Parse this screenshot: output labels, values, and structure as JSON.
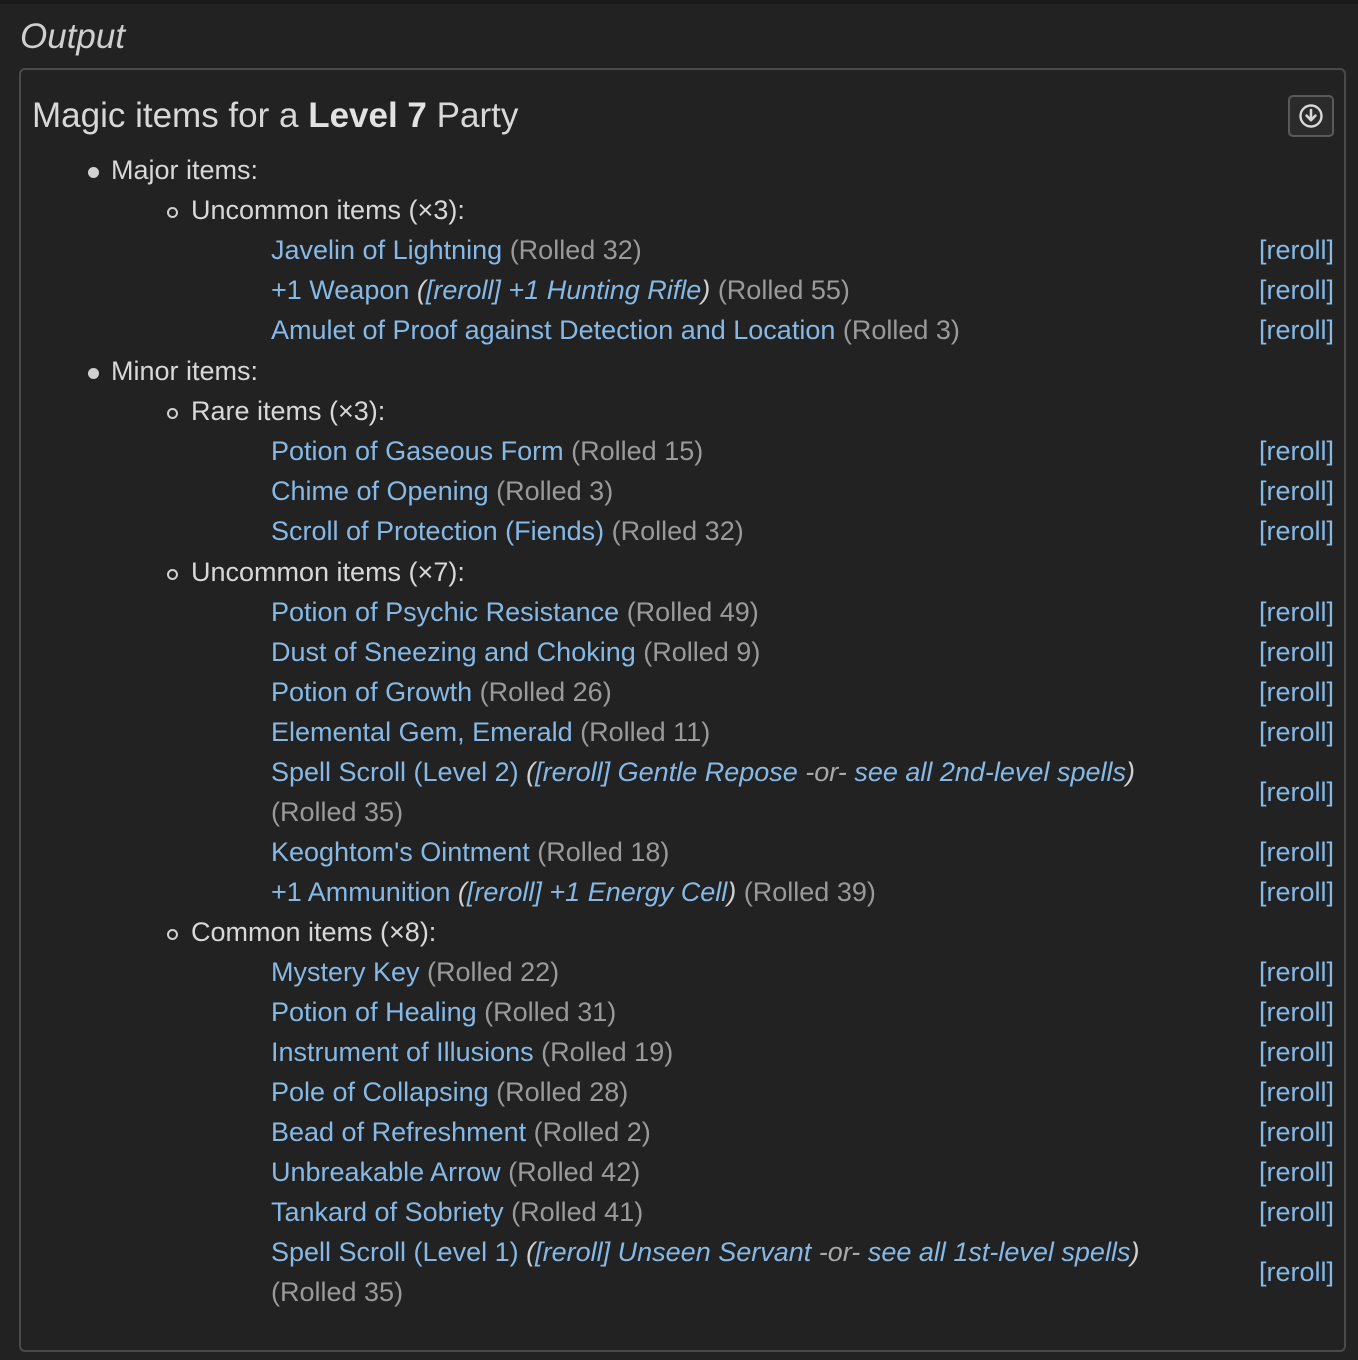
{
  "output_label": "Output",
  "title": {
    "prefix": "Magic items for a ",
    "level": "Level 7",
    "suffix": " Party"
  },
  "download_icon": "download-circle-icon",
  "reroll_label": "[reroll]",
  "or_label": "-or-",
  "groups": {
    "major": {
      "label": "Major items:"
    },
    "minor": {
      "label": "Minor items:"
    }
  },
  "categories": {
    "major_uncommon": "Uncommon items (×3):",
    "minor_rare": "Rare items (×3):",
    "minor_uncommon": "Uncommon items (×7):",
    "minor_common": "Common items (×8):"
  },
  "items": {
    "i1": {
      "name": "Javelin of Lightning",
      "rolled": "(Rolled 32)"
    },
    "i2": {
      "name": "+1 Weapon",
      "sub_open": "(",
      "sub_reroll": "[reroll]",
      "sub_name": "+1 Hunting Rifle",
      "sub_close": ")",
      "rolled": "(Rolled 55)"
    },
    "i3": {
      "name": "Amulet of Proof against Detection and Location",
      "rolled": "(Rolled 3)"
    },
    "i4": {
      "name": "Potion of Gaseous Form",
      "rolled": "(Rolled 15)"
    },
    "i5": {
      "name": "Chime of Opening",
      "rolled": "(Rolled 3)"
    },
    "i6": {
      "name": "Scroll of Protection (Fiends)",
      "rolled": "(Rolled 32)"
    },
    "i7": {
      "name": "Potion of Psychic Resistance",
      "rolled": "(Rolled 49)"
    },
    "i8": {
      "name": "Dust of Sneezing and Choking",
      "rolled": "(Rolled 9)"
    },
    "i9": {
      "name": "Potion of Growth",
      "rolled": "(Rolled 26)"
    },
    "i10": {
      "name": "Elemental Gem, Emerald",
      "rolled": "(Rolled 11)"
    },
    "i11": {
      "name": "Spell Scroll (Level 2)",
      "sub_open": "(",
      "sub_reroll": "[reroll]",
      "sub_name": "Gentle Repose",
      "see_all": "see all 2nd-level spells",
      "sub_close": ")",
      "rolled": "(Rolled 35)"
    },
    "i12": {
      "name": "Keoghtom's Ointment",
      "rolled": "(Rolled 18)"
    },
    "i13": {
      "name": "+1 Ammunition",
      "sub_open": "(",
      "sub_reroll": "[reroll]",
      "sub_name": "+1 Energy Cell",
      "sub_close": ")",
      "rolled": "(Rolled 39)"
    },
    "i14": {
      "name": "Mystery Key",
      "rolled": "(Rolled 22)"
    },
    "i15": {
      "name": "Potion of Healing",
      "rolled": "(Rolled 31)"
    },
    "i16": {
      "name": "Instrument of Illusions",
      "rolled": "(Rolled 19)"
    },
    "i17": {
      "name": "Pole of Collapsing",
      "rolled": "(Rolled 28)"
    },
    "i18": {
      "name": "Bead of Refreshment",
      "rolled": "(Rolled 2)"
    },
    "i19": {
      "name": "Unbreakable Arrow",
      "rolled": "(Rolled 42)"
    },
    "i20": {
      "name": "Tankard of Sobriety",
      "rolled": "(Rolled 41)"
    },
    "i21": {
      "name": "Spell Scroll (Level 1)",
      "sub_open": "(",
      "sub_reroll": "[reroll]",
      "sub_name": "Unseen Servant",
      "see_all": "see all 1st-level spells",
      "sub_close": ")",
      "rolled": "(Rolled 35)"
    }
  }
}
